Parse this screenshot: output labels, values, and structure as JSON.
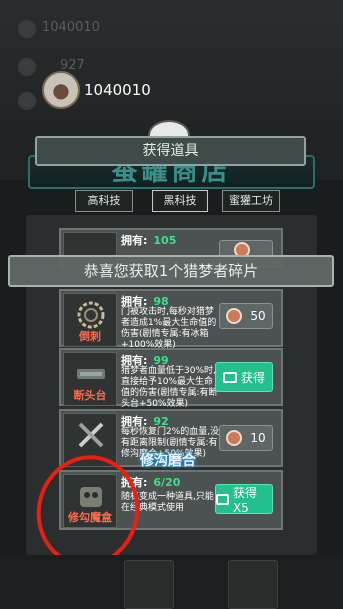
{
  "background": {
    "top_id": "1040010",
    "currency": "927",
    "banner": "蚕罐商店"
  },
  "player": {
    "avatar": "pig-face-icon",
    "id": "1040010"
  },
  "title_bar": "获得道具",
  "tabs": [
    {
      "label": "高科技"
    },
    {
      "label": "黑科技"
    },
    {
      "label": "蜜獾工坊"
    }
  ],
  "toast": "恭喜您获取1个猎梦者碎片",
  "items": [
    {
      "own_label": "拥有:",
      "own_value": "105",
      "name": "",
      "desc": "",
      "button": ""
    },
    {
      "own_label": "拥有:",
      "own_value": "98",
      "name": "倒刺",
      "desc": "门被攻击时,每秒对猎梦者造成1%最大生命值的伤害(剧情专属:有冰箱+100%效果)",
      "button": "50"
    },
    {
      "own_label": "拥有:",
      "own_value": "99",
      "name": "断头台",
      "desc": "猎梦者血量低于30%时,直接给予10%最大生命值的伤害(剧情专属:有断头台+50%效果)",
      "button": "获得"
    },
    {
      "own_label": "拥有:",
      "own_value": "92",
      "name": "修沟磨合",
      "desc": "每秒恢复门2%的血量,没有距离限制(剧情专属:有修沟磨合+50%效果)",
      "button": "10"
    },
    {
      "own_label": "拥有:",
      "own_value": "6/20",
      "name": "修勾魔盒",
      "desc": "随机变成一种道具,只能在经典模式使用",
      "button": "获得 X5"
    }
  ],
  "overlay_label": "修沟磨合",
  "colors": {
    "accent_green": "#22c08d",
    "count_green": "#3be08a",
    "item_name_red": "#ff6a4c",
    "annotation_red": "#e81f12"
  }
}
